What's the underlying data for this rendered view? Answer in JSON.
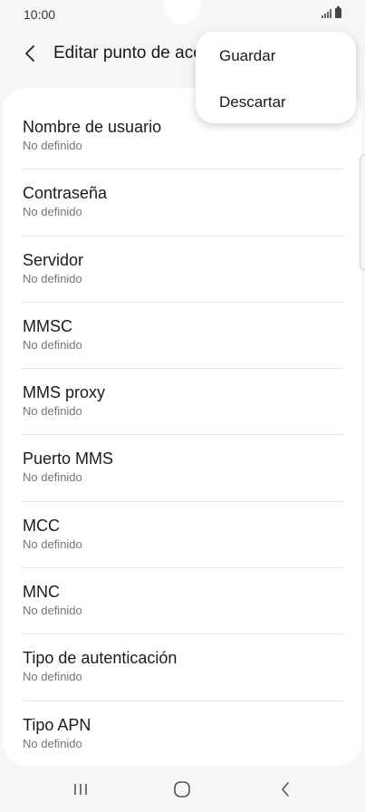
{
  "status_bar": {
    "time": "10:00"
  },
  "header": {
    "title": "Editar punto de acceso"
  },
  "menu": {
    "items": [
      {
        "label": "Guardar"
      },
      {
        "label": "Descartar"
      }
    ]
  },
  "settings": {
    "items": [
      {
        "title": "Nombre de usuario",
        "value": "No definido"
      },
      {
        "title": "Contraseña",
        "value": "No definido"
      },
      {
        "title": "Servidor",
        "value": "No definido"
      },
      {
        "title": "MMSC",
        "value": "No definido"
      },
      {
        "title": "MMS proxy",
        "value": "No definido"
      },
      {
        "title": "Puerto MMS",
        "value": "No definido"
      },
      {
        "title": "MCC",
        "value": "No definido"
      },
      {
        "title": "MNC",
        "value": "No definido"
      },
      {
        "title": "Tipo de autenticación",
        "value": "No definido"
      },
      {
        "title": "Tipo APN",
        "value": "No definido"
      }
    ]
  },
  "icons": {
    "status": [
      "signal-icon",
      "battery-icon"
    ],
    "header": [
      "back-arrow-icon"
    ],
    "navigation": [
      "recent-apps-icon",
      "home-icon",
      "back-icon"
    ]
  },
  "colors": {
    "background": "#f6f6f6",
    "card": "#ffffff",
    "text_primary": "#1b1b1b",
    "text_secondary": "#757575"
  }
}
